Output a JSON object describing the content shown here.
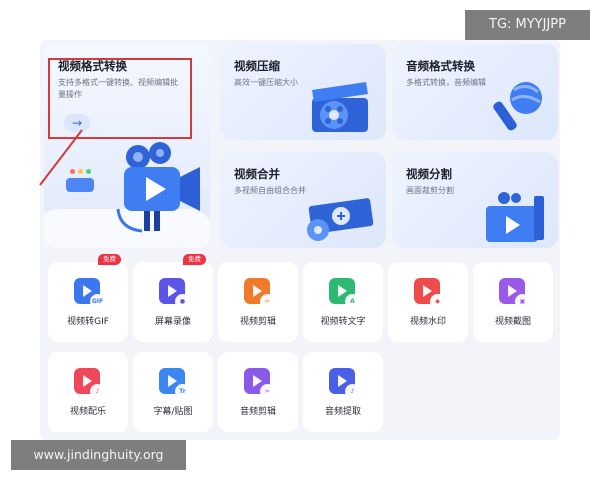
{
  "cards": [
    {
      "title": "视频格式转换",
      "desc": "支持多格式一键转换、视频编辑批量操作"
    },
    {
      "title": "视频压缩",
      "desc": "高效一键压缩大小"
    },
    {
      "title": "音频格式转换",
      "desc": "多格式转换，音频编辑"
    },
    {
      "title": "视频合并",
      "desc": "多视频自由组合合并"
    },
    {
      "title": "视频分割",
      "desc": "画面裁剪分割"
    }
  ],
  "tools": [
    {
      "label": "视频转GIF",
      "sub": "GIF",
      "badge": "免费",
      "color": "#3b78f0"
    },
    {
      "label": "屏幕录像",
      "sub": "●",
      "badge": "免费",
      "color": "#5a55e8"
    },
    {
      "label": "视频剪辑",
      "sub": "✂",
      "badge": "",
      "color": "#f07a2c"
    },
    {
      "label": "视频转文字",
      "sub": "A",
      "badge": "",
      "color": "#2db873"
    },
    {
      "label": "视频水印",
      "sub": "◆",
      "badge": "",
      "color": "#ee4b4b"
    },
    {
      "label": "视频截图",
      "sub": "▣",
      "badge": "",
      "color": "#9a5ae8"
    },
    {
      "label": "视频配乐",
      "sub": "♪",
      "badge": "",
      "color": "#f0485a"
    },
    {
      "label": "字幕/贴图",
      "sub": "Tr",
      "badge": "",
      "color": "#3b86f0"
    },
    {
      "label": "音频剪辑",
      "sub": "✂",
      "badge": "",
      "color": "#8a5ae8"
    },
    {
      "label": "音频提取",
      "sub": "♪",
      "badge": "",
      "color": "#4a5ee8"
    }
  ],
  "convert_arrow": "→",
  "watermarks": {
    "tg": "TG: MYYJJPP",
    "url": "www.jindinghuity.org"
  },
  "colors": {
    "accent": "#2a66f0",
    "highlight": "#d23b3b",
    "badge": "#ee3344"
  }
}
